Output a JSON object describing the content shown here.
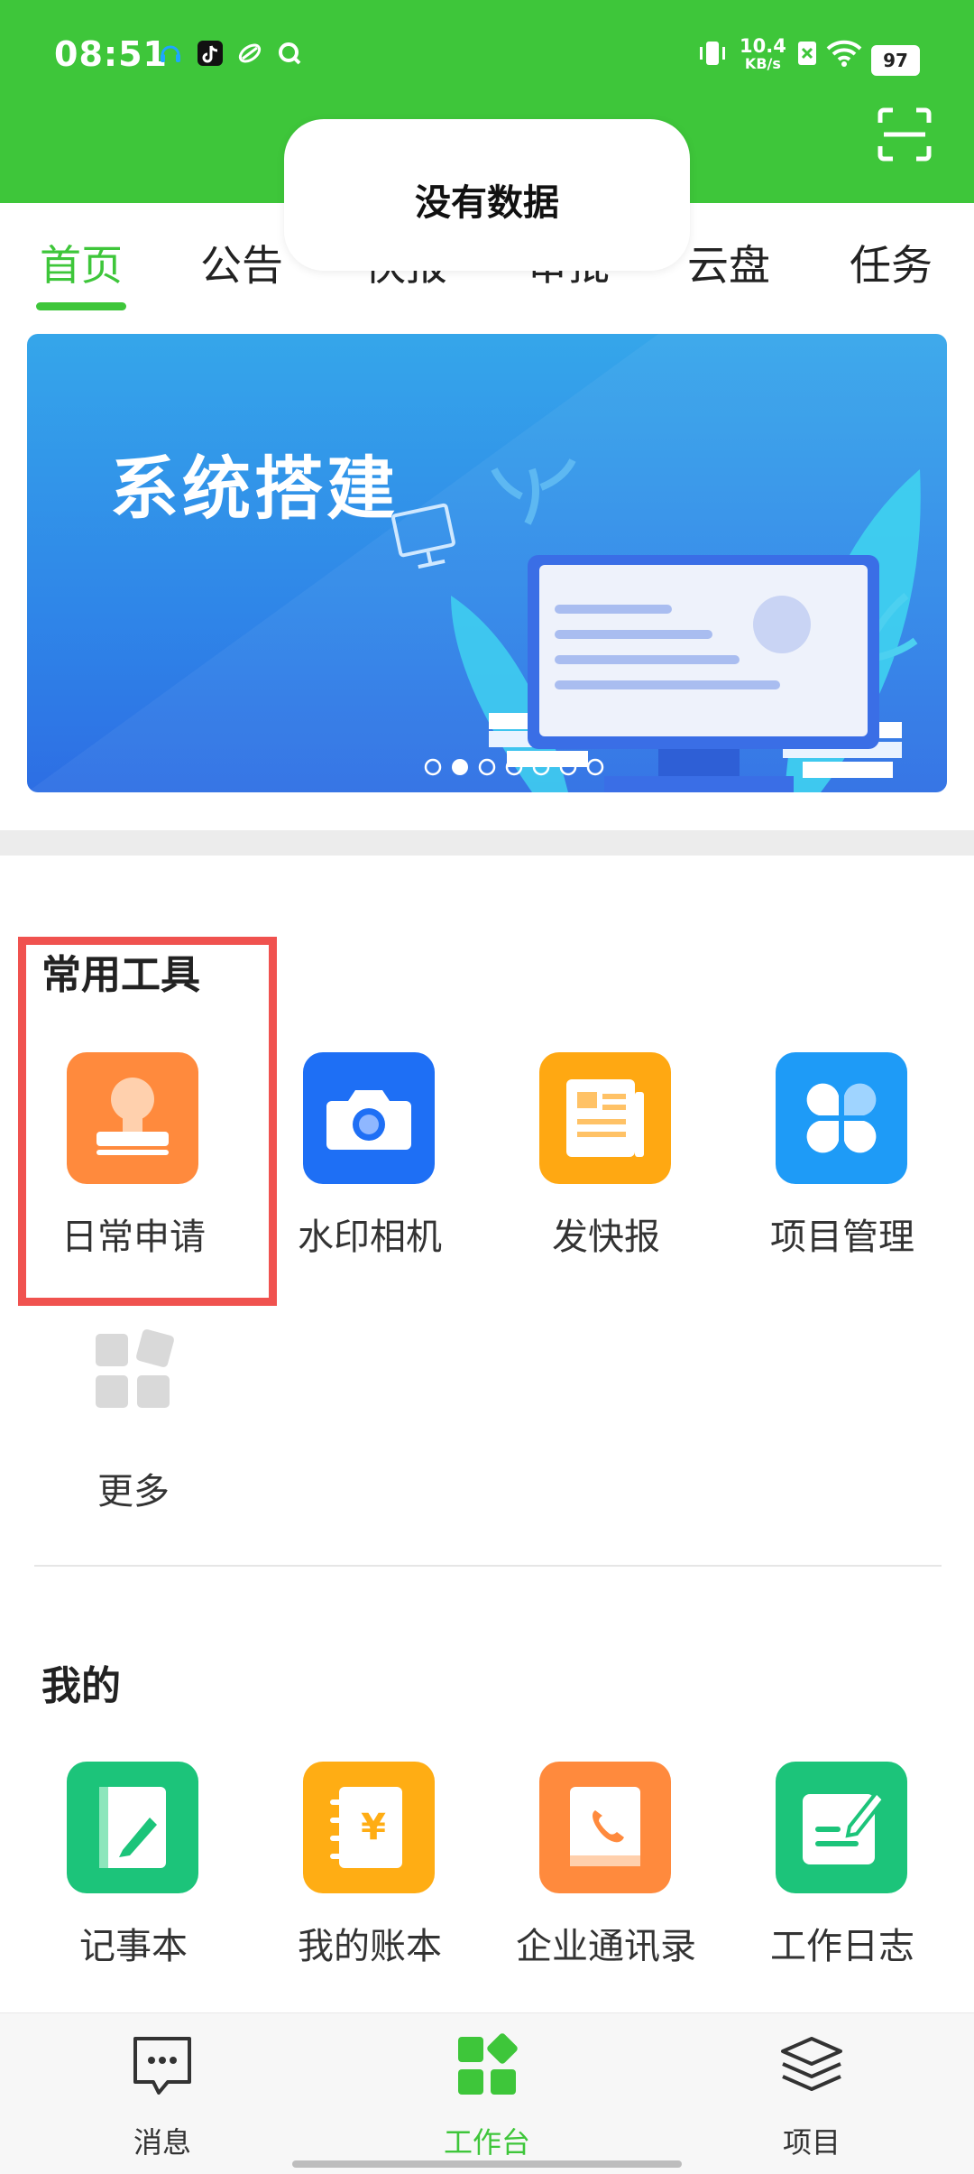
{
  "status_bar": {
    "time": "08:51",
    "net_speed_value": "10.4",
    "net_speed_unit": "KB/s",
    "battery": "97"
  },
  "header": {
    "title": "",
    "scan_icon": "scan-icon"
  },
  "toast": {
    "message": "没有数据"
  },
  "tabs": [
    {
      "label": "首页",
      "active": true
    },
    {
      "label": "公告"
    },
    {
      "label": "快报"
    },
    {
      "label": "审批"
    },
    {
      "label": "云盘"
    },
    {
      "label": "任务"
    }
  ],
  "banner": {
    "title": "系统搭建",
    "page_count": 7,
    "current_page": 2
  },
  "common_tools": {
    "title": "常用工具",
    "items": [
      {
        "label": "日常申请",
        "icon": "stamp-icon",
        "color": "#ff8a3d"
      },
      {
        "label": "水印相机",
        "icon": "camera-icon",
        "color": "#1e6ff5"
      },
      {
        "label": "发快报",
        "icon": "newspaper-icon",
        "color": "#ffa812"
      },
      {
        "label": "项目管理",
        "icon": "clover-icon",
        "color": "#1e9bf7"
      },
      {
        "label": "更多",
        "icon": "more-grid-icon",
        "color": "#d9d9d9"
      }
    ]
  },
  "mine": {
    "title": "我的",
    "items": [
      {
        "label": "记事本",
        "icon": "notebook-icon",
        "color": "#1cc47a"
      },
      {
        "label": "我的账本",
        "icon": "ledger-icon",
        "color": "#ffad14"
      },
      {
        "label": "企业通讯录",
        "icon": "contacts-icon",
        "color": "#ff8a3d"
      },
      {
        "label": "工作日志",
        "icon": "worklog-icon",
        "color": "#1cc47a"
      }
    ]
  },
  "bottom_nav": [
    {
      "label": "消息",
      "icon": "message-icon"
    },
    {
      "label": "工作台",
      "icon": "workbench-icon",
      "active": true
    },
    {
      "label": "项目",
      "icon": "layers-icon"
    }
  ],
  "colors": {
    "brand_green": "#3ec63a",
    "highlight_red": "#f0524f"
  }
}
